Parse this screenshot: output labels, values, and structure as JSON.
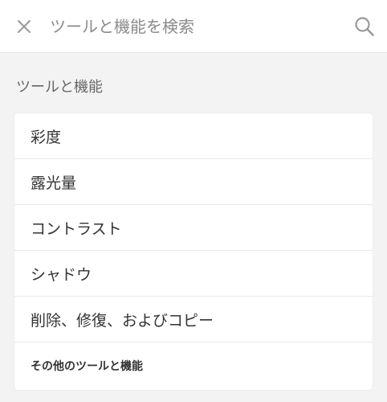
{
  "search": {
    "placeholder": "ツールと機能を検索"
  },
  "section": {
    "title": "ツールと機能"
  },
  "tools": [
    {
      "label": "彩度"
    },
    {
      "label": "露光量"
    },
    {
      "label": "コントラスト"
    },
    {
      "label": "シャドウ"
    },
    {
      "label": "削除、修復、およびコピー"
    }
  ],
  "more_link": "その他のツールと機能",
  "icons": {
    "close": "close-icon",
    "search": "search-icon"
  }
}
